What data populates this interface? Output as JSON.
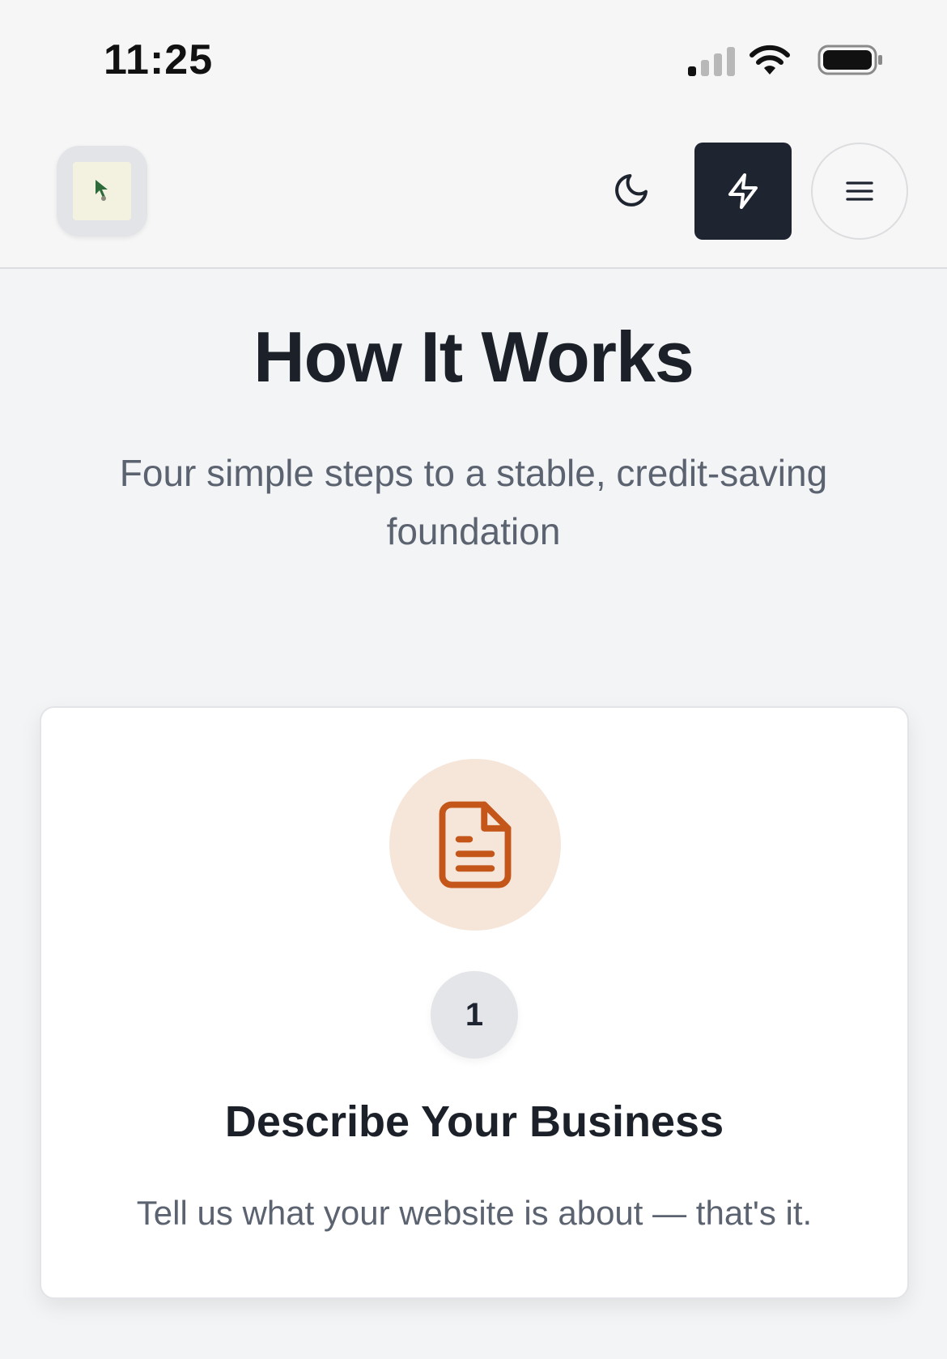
{
  "status_bar": {
    "time": "11:25"
  },
  "header": {
    "logo_alt": "site-logo",
    "icons": {
      "theme": "moon-icon",
      "quick": "lightning-bolt-icon",
      "menu": "hamburger-menu-icon"
    }
  },
  "hero": {
    "title": "How It Works",
    "subtitle": "Four simple steps to a stable, credit-saving foundation"
  },
  "steps": [
    {
      "number": "1",
      "icon": "document-icon",
      "title": "Describe Your Business",
      "description": "Tell us what your website is about — that's it."
    }
  ],
  "colors": {
    "accent": "#c4561a",
    "accent_bg": "#f6e6da",
    "dark_button": "#1f2530",
    "page_bg": "#f3f4f5"
  }
}
